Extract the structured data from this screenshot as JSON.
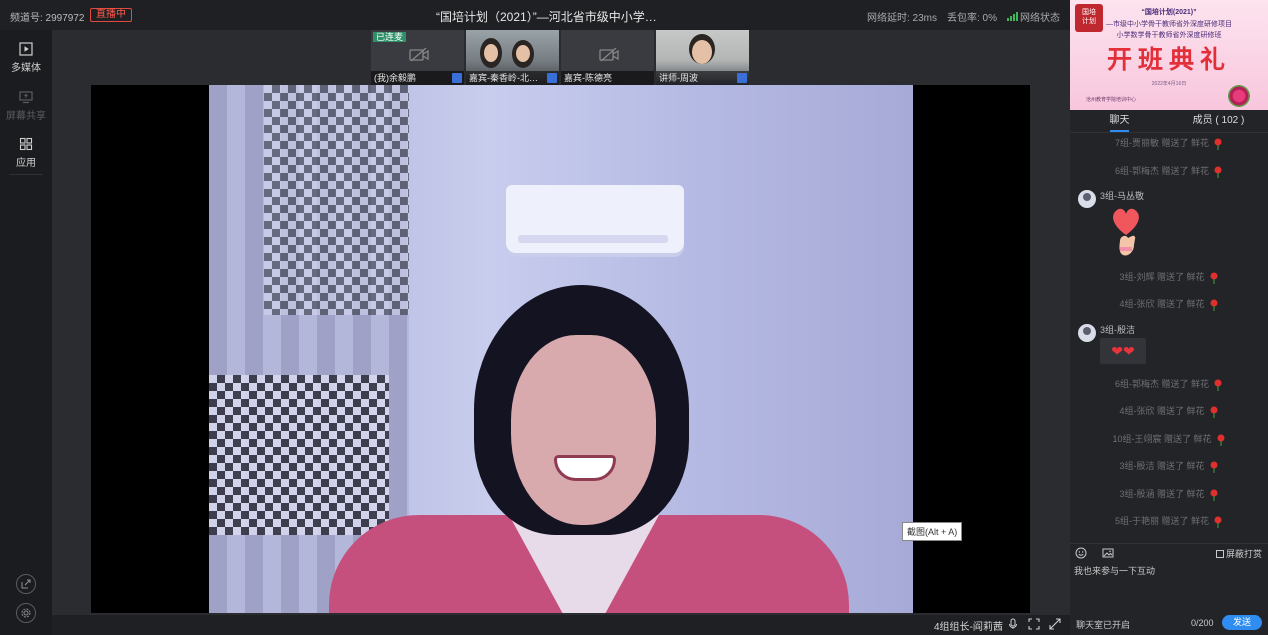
{
  "topbar": {
    "channel": "频道号: 2997972",
    "live_badge": "直播中",
    "title": "“国培计划（2021）”—河北省市级中小学…",
    "latency": "网络延时: 23ms",
    "packet_loss": "丢包率: 0%",
    "network_status": "网络状态"
  },
  "left_toolbar": {
    "items": [
      {
        "label": "多媒体",
        "icon": "media-play-icon",
        "enabled": true
      },
      {
        "label": "屏幕共享",
        "icon": "screen-share-icon",
        "enabled": false
      },
      {
        "label": "应用",
        "icon": "apps-grid-icon",
        "enabled": true
      }
    ],
    "bottom_icons": [
      "popout-icon",
      "settings-icon"
    ]
  },
  "thumbnails": [
    {
      "label": "(我)余毅鹏",
      "tag": "已连麦",
      "camera": "off"
    },
    {
      "label": "嘉宾-秦香岭-北…",
      "tag": "",
      "camera": "on"
    },
    {
      "label": "嘉宾-陈德亮",
      "tag": "",
      "camera": "off"
    },
    {
      "label": "讲师-周波",
      "tag": "",
      "camera": "on"
    }
  ],
  "video": {
    "tooltip": "截图(Alt + A)",
    "speaker": "4组组长-阎莉茜"
  },
  "banner": {
    "seal": "国培计划",
    "line1": "“国培计划(2021)”",
    "line2": "—市级中小学骨干教师省外深度研修项目",
    "line3": "小学数学骨干教师省外深度研修班",
    "headline": "开班典礼",
    "date": "2022年4月16日",
    "org": "沧州教育学院培训中心"
  },
  "panel": {
    "tabs": [
      {
        "label": "聊天",
        "active": true
      },
      {
        "label": "成员 ( 102 )",
        "active": false
      }
    ]
  },
  "chat": {
    "gift_suffix": "赠送了 鲜花",
    "gifts_top": [
      "7组-贾丽敏",
      "6组-郭梅杰"
    ],
    "messages": [
      {
        "name": "3组-马丛敬",
        "type": "sticker",
        "content": "heart-hand-sticker"
      },
      {
        "name": "3组-殷洁",
        "type": "emoji",
        "content": "❤❤"
      }
    ],
    "gifts_mid": [
      "3组-刘辉",
      "4组-张欣"
    ],
    "gifts_bottom": [
      "6组-郭梅杰",
      "4组-张欣",
      "10组-王翊宸",
      "3组-殷洁",
      "3组-殷涵",
      "5组-于艳丽"
    ]
  },
  "composer": {
    "shield_label": "屏蔽打赏",
    "placeholder": "我也来参与一下互动",
    "status": "聊天室已开启",
    "counter": "0/200",
    "send_label": "发送"
  },
  "colors": {
    "accent": "#2f8cf0",
    "live_red": "#e04b3f",
    "gift_red": "#e0302e"
  }
}
